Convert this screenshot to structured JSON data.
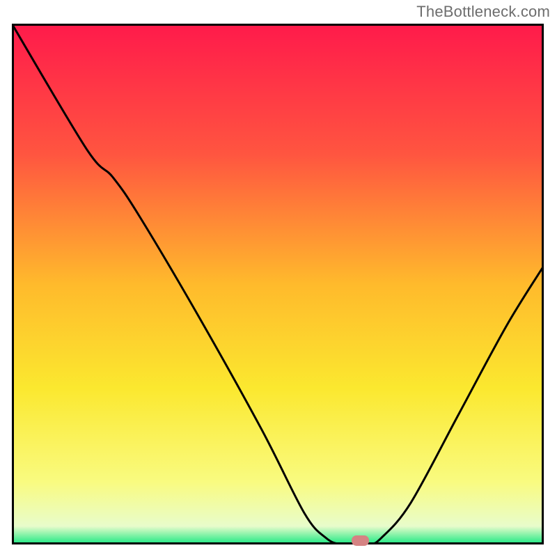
{
  "attribution": "TheBottleneck.com",
  "chart_data": {
    "type": "line",
    "title": "",
    "xlabel": "",
    "ylabel": "",
    "x_range": [
      0,
      100
    ],
    "y_range": [
      0,
      100
    ],
    "gradient_stops": [
      {
        "offset": 0,
        "color": "#ff1a4b"
      },
      {
        "offset": 25,
        "color": "#ff5540"
      },
      {
        "offset": 50,
        "color": "#ffba2c"
      },
      {
        "offset": 70,
        "color": "#fbe82f"
      },
      {
        "offset": 88,
        "color": "#f9fb80"
      },
      {
        "offset": 96.5,
        "color": "#e8fccb"
      },
      {
        "offset": 100,
        "color": "#17e881"
      }
    ],
    "curve_points": [
      {
        "x": 0.0,
        "y": 100.0
      },
      {
        "x": 14.0,
        "y": 76.0
      },
      {
        "x": 19.0,
        "y": 70.5
      },
      {
        "x": 24.0,
        "y": 63.0
      },
      {
        "x": 35.0,
        "y": 44.0
      },
      {
        "x": 47.0,
        "y": 22.0
      },
      {
        "x": 55.0,
        "y": 6.0
      },
      {
        "x": 59.0,
        "y": 1.3
      },
      {
        "x": 62.0,
        "y": 0.0
      },
      {
        "x": 67.0,
        "y": 0.0
      },
      {
        "x": 69.5,
        "y": 1.3
      },
      {
        "x": 75.0,
        "y": 8.0
      },
      {
        "x": 84.0,
        "y": 25.0
      },
      {
        "x": 93.0,
        "y": 42.0
      },
      {
        "x": 100.0,
        "y": 53.5
      }
    ],
    "marker": {
      "x": 65.5,
      "y": 0.8
    },
    "marker_color": "#d58383",
    "frame_color": "#000000",
    "curve_color": "#000000"
  }
}
